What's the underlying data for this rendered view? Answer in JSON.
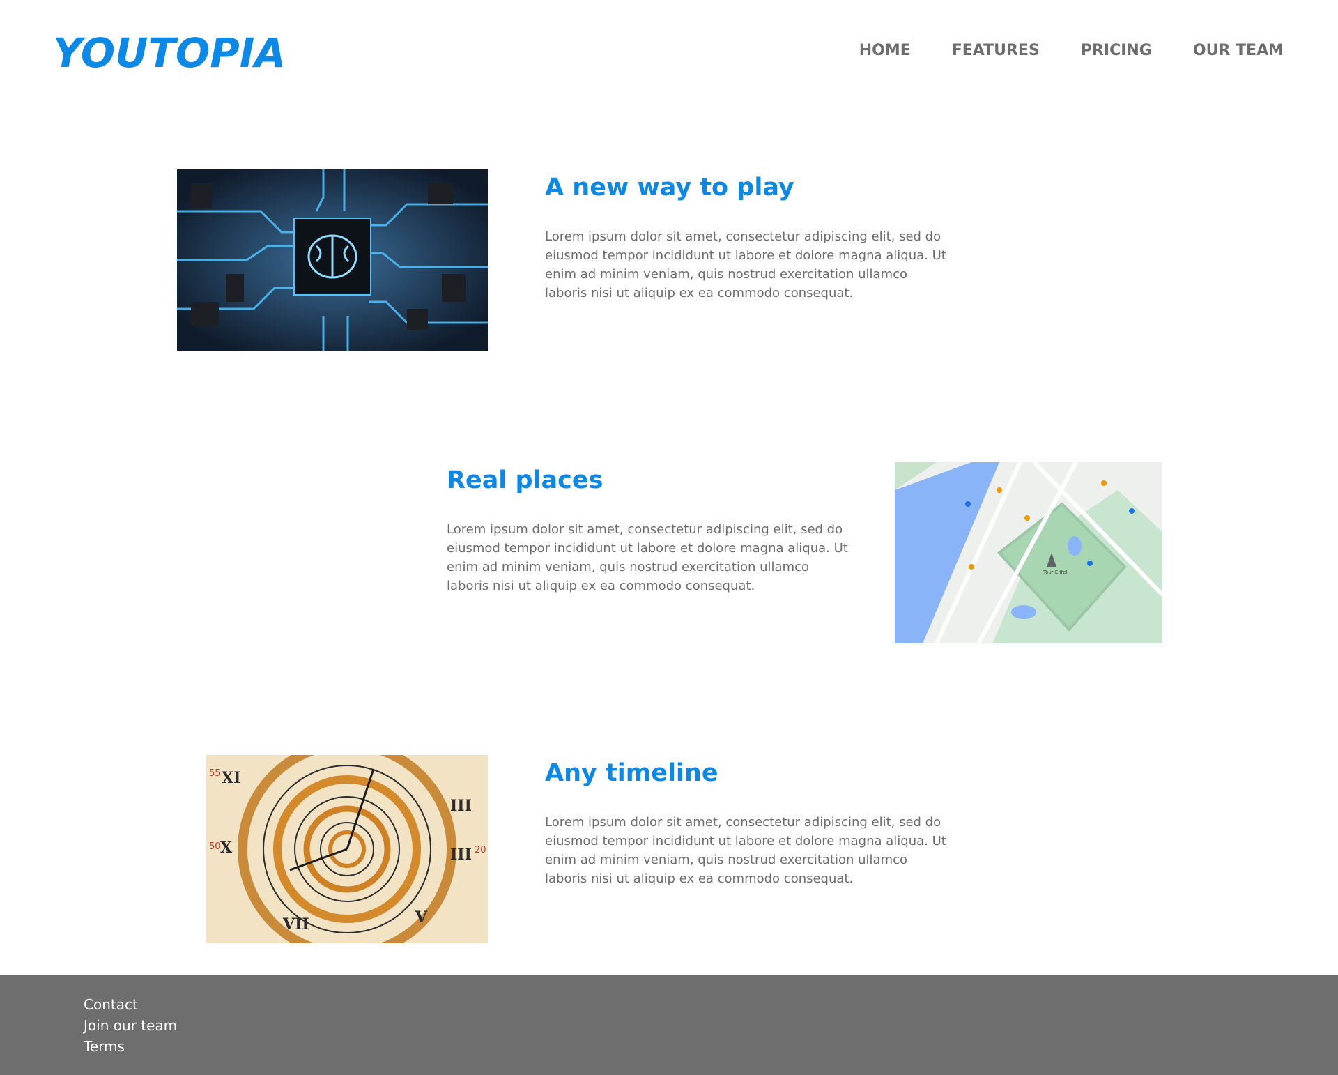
{
  "header": {
    "logo": "YOUTOPIA",
    "nav": [
      {
        "label": "HOME"
      },
      {
        "label": "FEATURES"
      },
      {
        "label": "PRICING"
      },
      {
        "label": "OUR TEAM"
      }
    ]
  },
  "features": [
    {
      "title": "A new way to play",
      "body": "Lorem ipsum dolor sit amet, consectetur adipiscing elit, sed do eiusmod tempor incididunt ut labore et dolore magna aliqua. Ut enim ad minim veniam, quis nostrud exercitation ullamco laboris nisi ut aliquip ex ea commodo consequat.",
      "image": "circuit-brain-image"
    },
    {
      "title": "Real places",
      "body": "Lorem ipsum dolor sit amet, consectetur adipiscing elit, sed do eiusmod tempor incididunt ut labore et dolore magna aliqua. Ut enim ad minim veniam, quis nostrud exercitation ullamco laboris nisi ut aliquip ex ea commodo consequat.",
      "image": "map-image",
      "map_label": "Tour Eiffel"
    },
    {
      "title": "Any timeline",
      "body": "Lorem ipsum dolor sit amet, consectetur adipiscing elit, sed do eiusmod tempor incididunt ut labore et dolore magna aliqua. Ut enim ad minim veniam, quis nostrud exercitation ullamco laboris nisi ut aliquip ex ea commodo consequat.",
      "image": "spiral-clock-image"
    }
  ],
  "footer": {
    "links": [
      {
        "label": "Contact"
      },
      {
        "label": "Join our team"
      },
      {
        "label": "Terms"
      }
    ]
  },
  "colors": {
    "accent": "#0c88e6",
    "nav_text": "#6d6d6d",
    "body_text": "#6d6d6d",
    "footer_bg": "#6e6e6e",
    "footer_text": "#ffffff"
  }
}
